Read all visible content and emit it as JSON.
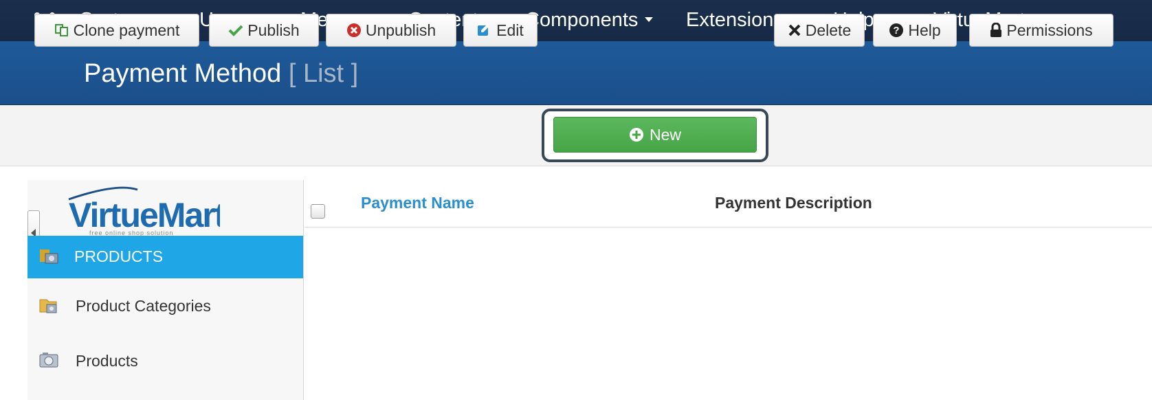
{
  "nav": {
    "items": [
      "System",
      "Users",
      "Menus",
      "Content",
      "Components",
      "Extensions",
      "Help",
      "VirtueMart"
    ]
  },
  "header": {
    "title": "Payment Method",
    "subtitle": "[ List ]"
  },
  "toolbar": {
    "clone_label": "Clone payment",
    "publish_label": "Publish",
    "unpublish_label": "Unpublish",
    "edit_label": "Edit",
    "new_label": "New",
    "delete_label": "Delete",
    "help_label": "Help",
    "permissions_label": "Permissions"
  },
  "sidebar": {
    "logo_text": "VirtueMart",
    "logo_tagline": "free online shop solution",
    "items": [
      {
        "label": "PRODUCTS",
        "active": true,
        "icon": "products-icon"
      },
      {
        "label": "Product Categories",
        "active": false,
        "icon": "folder-icon"
      },
      {
        "label": "Products",
        "active": false,
        "icon": "camera-icon"
      }
    ]
  },
  "table": {
    "columns": [
      "Payment Name",
      "Payment Description"
    ]
  },
  "colors": {
    "navbar": "#1b2f4d",
    "titlebar": "#1f5a99",
    "accent_green": "#5cb85c",
    "sidebar_active": "#1fa6e6",
    "link": "#2a8fcf"
  }
}
